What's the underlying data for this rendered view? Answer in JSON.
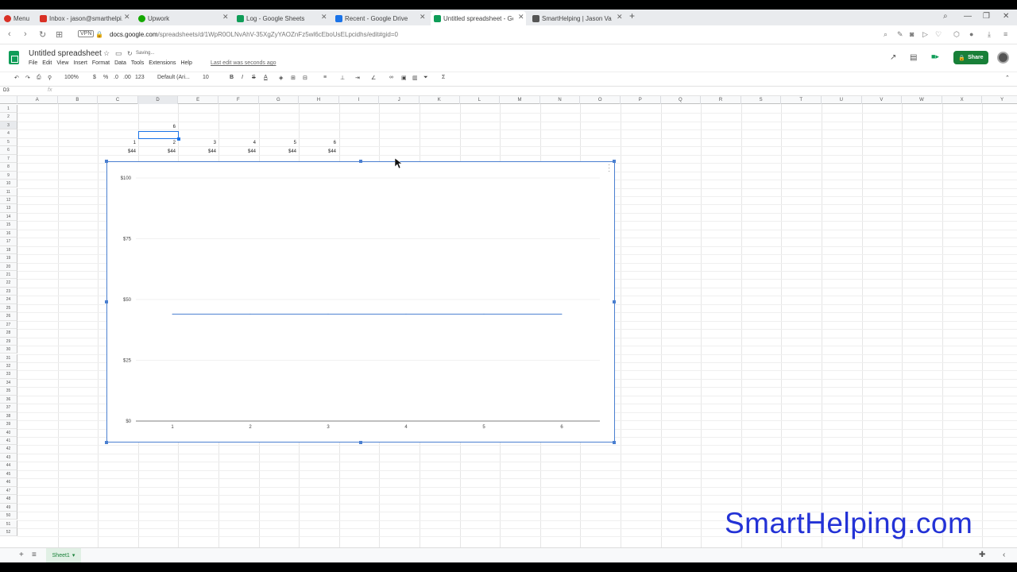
{
  "browser": {
    "tabs": [
      {
        "label": "Menu",
        "color": "#d93025"
      },
      {
        "label": "Inbox - jason@smarthelpi...",
        "color": "#d93025"
      },
      {
        "label": "Upwork",
        "color": "#14a800"
      },
      {
        "label": "Log - Google Sheets",
        "color": "#0f9d58"
      },
      {
        "label": "Recent - Google Drive",
        "color": "#1a73e8"
      },
      {
        "label": "Untitled spreadsheet - Goo...",
        "color": "#0f9d58"
      },
      {
        "label": "SmartHelping | Jason Varn...",
        "color": "#555555"
      }
    ],
    "new_tab": "+",
    "url_prefix": "docs.google.com",
    "url_rest": "/spreadsheets/d/1WpR0OLNvAhV-35XgZyYAOZnFz5wl6cEboUsELpcidhs/edit#gid=0",
    "vpn": "VPN"
  },
  "doc": {
    "title": "Untitled spreadsheet",
    "saving": "Saving...",
    "menus": [
      "File",
      "Edit",
      "View",
      "Insert",
      "Format",
      "Data",
      "Tools",
      "Extensions",
      "Help"
    ],
    "last_edit": "Last edit was seconds ago",
    "share": "Share"
  },
  "toolbar": {
    "zoom": "100%",
    "currency": "$",
    "percent": "%",
    "dec_decrease": ".0",
    "dec_increase": ".00",
    "format_more": "123",
    "font": "Default (Ari...",
    "font_size": "10",
    "bold": "B",
    "italic": "I",
    "strike": "S",
    "text_color": "A",
    "sigma": "Σ"
  },
  "formula_bar": {
    "namebox": "D3",
    "fx": "fx"
  },
  "columns": [
    "A",
    "B",
    "C",
    "D",
    "E",
    "F",
    "G",
    "H",
    "I",
    "J",
    "K",
    "L",
    "M",
    "N",
    "O",
    "P",
    "Q",
    "R",
    "S",
    "T",
    "U",
    "V",
    "W",
    "X",
    "Y"
  ],
  "rows_count": 52,
  "cells": {
    "d2": "6",
    "row4": [
      "1",
      "2",
      "3",
      "4",
      "5",
      "6"
    ],
    "row5": [
      "$44",
      "$44",
      "$44",
      "$44",
      "$44",
      "$44"
    ]
  },
  "chart_data": {
    "type": "line",
    "categories": [
      "1",
      "2",
      "3",
      "4",
      "5",
      "6"
    ],
    "series": [
      {
        "values": [
          44,
          44,
          44,
          44,
          44,
          44
        ],
        "color": "#4a7fd0"
      }
    ],
    "y_ticks": [
      "$0",
      "$25",
      "$50",
      "$75",
      "$100"
    ],
    "ylim": [
      0,
      100
    ],
    "grid": true,
    "title": "",
    "xlabel": "",
    "ylabel": ""
  },
  "sheet": {
    "tab": "Sheet1"
  },
  "watermark": "SmartHelping.com"
}
